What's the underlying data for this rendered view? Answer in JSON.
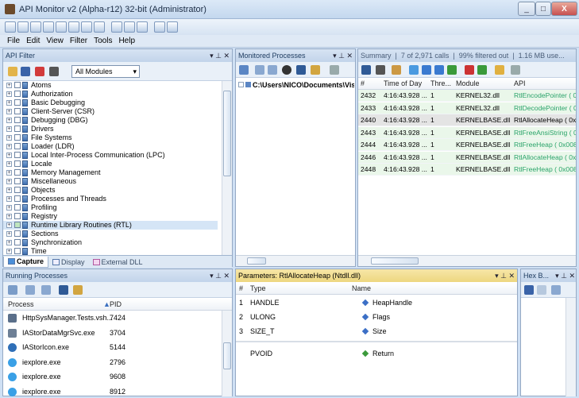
{
  "window": {
    "title": "API Monitor v2 (Alpha-r12) 32-bit (Administrator)",
    "min": "_",
    "max": "□",
    "close": "X"
  },
  "menu": [
    "File",
    "Edit",
    "View",
    "Filter",
    "Tools",
    "Help"
  ],
  "api_filter": {
    "title": "API Filter",
    "controls": "▾ ⊥ ✕",
    "module_select": "All Modules",
    "items": [
      "Atoms",
      "Authorization",
      "Basic Debugging",
      "Client-Server (CSR)",
      "Debugging (DBG)",
      "Drivers",
      "File Systems",
      "Loader (LDR)",
      "Local Inter-Process Communication (LPC)",
      "Locale",
      "Memory Management",
      "Miscellaneous",
      "Objects",
      "Processes and Threads",
      "Profiling",
      "Registry",
      "Runtime Library Routines (RTL)",
      "Sections",
      "Synchronization",
      "Time"
    ],
    "tabs": [
      "Capture",
      "Display",
      "External DLL"
    ]
  },
  "monitored": {
    "title": "Monitored Processes",
    "controls": "▾ ⊥ ✕",
    "path": "C:\\Users\\NICO\\Documents\\Visu"
  },
  "summary": {
    "tab": "Summary",
    "calls": "7 of 2,971 calls",
    "filtered": "99% filtered out",
    "memory": "1.16 MB use...",
    "headers": [
      "#",
      "Time of Day",
      "Thre...",
      "Module",
      "API"
    ],
    "rows": [
      [
        "2432",
        "4:16:43.928 ...",
        "1",
        "KERNEL32.dll",
        "RtlEncodePointer ( 0x"
      ],
      [
        "2433",
        "4:16:43.928 ...",
        "1",
        "KERNEL32.dll",
        "RtlDecodePointer ( 0x"
      ],
      [
        "2440",
        "4:16:43.928 ...",
        "1",
        "KERNELBASE.dll",
        "RtlAllocateHeap ( 0x0"
      ],
      [
        "2443",
        "4:16:43.928 ...",
        "1",
        "KERNELBASE.dll",
        "RtlFreeAnsiString ( 0x"
      ],
      [
        "2444",
        "4:16:43.928 ...",
        "1",
        "KERNELBASE.dll",
        "RtlFreeHeap ( 0x008"
      ],
      [
        "2446",
        "4:16:43.928 ...",
        "1",
        "KERNELBASE.dll",
        "RtlAllocateHeap ( 0x0"
      ],
      [
        "2448",
        "4:16:43.928 ...",
        "1",
        "KERNELBASE.dll",
        "RtlFreeHeap ( 0x008"
      ]
    ],
    "selected_index": 2
  },
  "running": {
    "title": "Running Processes",
    "controls": "▾ ⊥ ✕",
    "headers": [
      "Process",
      "PID"
    ],
    "rows": [
      {
        "name": "HttpSysManager.Tests.vsh...",
        "pid": "7424",
        "color": "#5a6f8a"
      },
      {
        "name": "IAStorDataMgrSvc.exe",
        "pid": "3704",
        "color": "#6d7f95"
      },
      {
        "name": "IAStorIcon.exe",
        "pid": "5144",
        "color": "#2f6fb7"
      },
      {
        "name": "iexplore.exe",
        "pid": "2796",
        "color": "#3aa0e6"
      },
      {
        "name": "iexplore.exe",
        "pid": "9608",
        "color": "#3aa0e6"
      },
      {
        "name": "iexplore.exe",
        "pid": "8912",
        "color": "#3aa0e6"
      }
    ]
  },
  "params": {
    "title": "Parameters: RtlAllocateHeap (Ntdll.dll)",
    "controls": "▾ ⊥ ✕",
    "headers": [
      "#",
      "Type",
      "Name"
    ],
    "rows": [
      [
        "1",
        "HANDLE",
        "HeapHandle"
      ],
      [
        "2",
        "ULONG",
        "Flags"
      ],
      [
        "3",
        "SIZE_T",
        "Size"
      ]
    ],
    "ret": {
      "type": "PVOID",
      "name": "Return"
    }
  },
  "hex": {
    "title": "Hex B...",
    "controls": "▾ ⊥ ✕"
  }
}
